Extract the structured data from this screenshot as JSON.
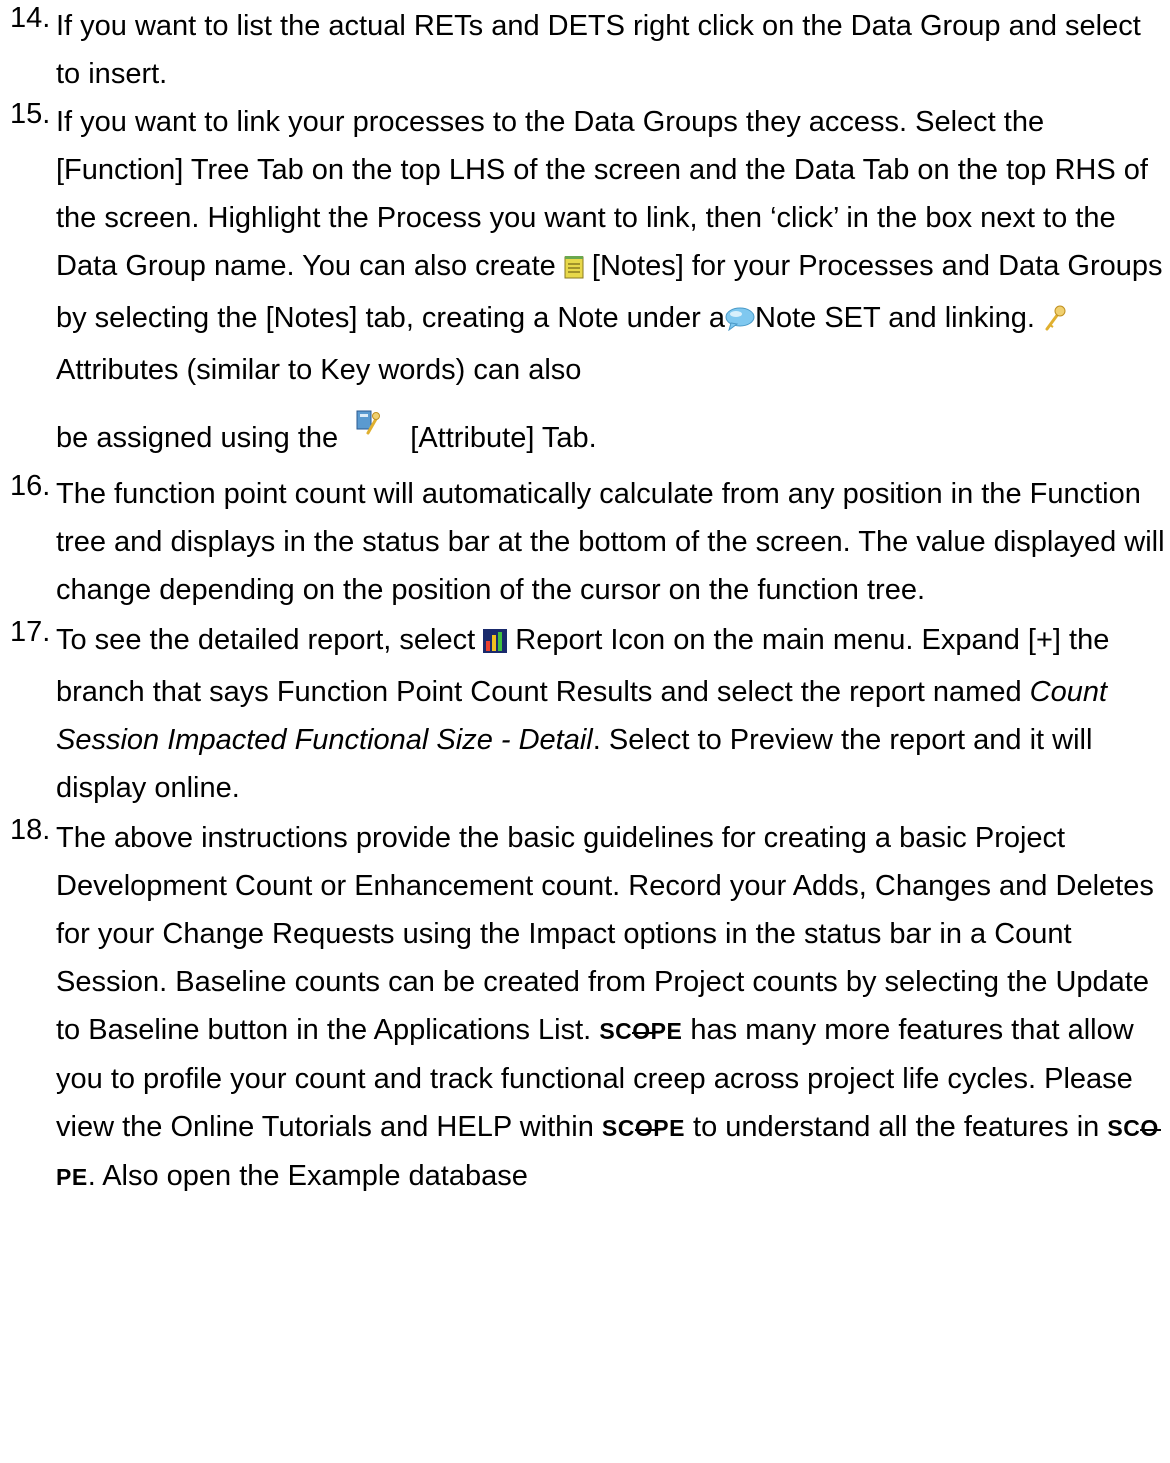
{
  "steps": [
    {
      "number": "14.",
      "text": "If you want to list the actual RETs and DETS right click on the Data Group and select to insert."
    },
    {
      "number": "15.",
      "part1": "If you want to link your processes to the Data Groups they access. Select the [Function] Tree Tab on the top LHS of the screen and the Data Tab on the top RHS of the screen.  Highlight the Process you want to link, then ‘click’ in the box next to the Data Group name.  You can also create",
      "part2": "[Notes] for your Processes and Data Groups by selecting the [Notes] tab, creating a Note under a",
      "part3": "Note SET and linking.",
      "part4": "Attributes (similar to Key words) can also",
      "part5": "be assigned using the",
      "part6": "[Attribute] Tab."
    },
    {
      "number": "16.",
      "text": "The function point count will automatically calculate from any position in the Function tree and displays in the status bar at the bottom of the screen. The value displayed will change depending on the position of the cursor on the function tree."
    },
    {
      "number": "17.",
      "part1": "To see the detailed report, select",
      "part2": "Report Icon on the main menu.  Expand [+] the branch that says Function Point Count Results and select the report named",
      "italic": "Count Session Impacted Functional Size - Detail",
      "part3": ". Select to Preview the report and it will display online."
    },
    {
      "number": "18.",
      "part1": "The above instructions provide the basic guidelines for creating a basic Project Development Count or Enhancement count. Record your Adds, Changes and Deletes for your Change Requests using the Impact options in the status bar in a Count Session.  Baseline counts can be created from Project counts by selecting the Update to Baseline button in the Applications List.",
      "part2": "has many more features that allow you to profile your count and track functional creep across project life cycles.  Please view the Online Tutorials and HELP within",
      "part3": "to understand all the features in",
      "part4": ". Also open the Example database"
    }
  ],
  "brand": {
    "pre": "SC",
    "o": "O",
    "post": "PE"
  },
  "icons": {
    "notes": "notes-icon",
    "note_set": "speech-bubble-icon",
    "attributes": "key-icon",
    "attribute_tab": "attribute-tab-icon",
    "report": "report-chart-icon"
  },
  "colors": {
    "text": "#000000",
    "notes_icon": "#e8d84a",
    "bubble_icon": "#7fc8f0",
    "key_icon": "#e0b030",
    "report_bg": "#1a2a6c"
  }
}
